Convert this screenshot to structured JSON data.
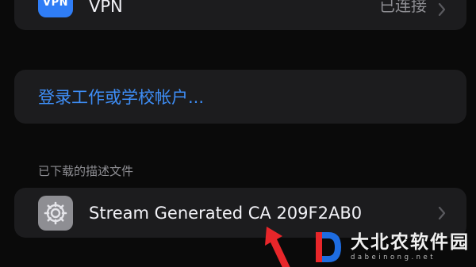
{
  "vpn_row": {
    "icon_text": "VPN",
    "label": "VPN",
    "status": "已连接"
  },
  "login_row": {
    "label": "登录工作或学校帐户..."
  },
  "profiles_section": {
    "header": "已下载的描述文件",
    "items": [
      {
        "label": "Stream Generated CA 209F2AB0",
        "icon": "gear-icon"
      }
    ]
  },
  "watermark": {
    "title": "大北农软件园",
    "subtitle": "dabeinong.net"
  },
  "colors": {
    "background": "#0a0a0a",
    "group_background": "#1c1c1e",
    "link_blue": "#3e8ef7",
    "vpn_icon_blue": "#2f7df6",
    "secondary_text": "#8e8e93",
    "annotation_arrow_red": "#e8262a"
  }
}
